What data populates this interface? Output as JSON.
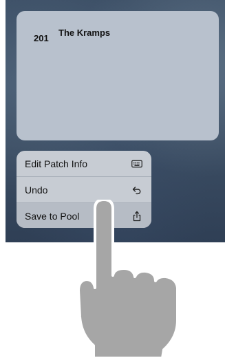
{
  "patch": {
    "number": "201",
    "name": "The Kramps"
  },
  "context_menu": {
    "items": [
      {
        "label": "Edit Patch Info",
        "icon": "keyboard-icon"
      },
      {
        "label": "Undo",
        "icon": "undo-arrow-icon"
      },
      {
        "label": "Save to Pool",
        "icon": "share-icon"
      }
    ]
  },
  "colors": {
    "background": "#3f5269",
    "patch_card": "#b8c1cd",
    "menu": "#c7ccd3",
    "hand": "#a6a6a6"
  }
}
